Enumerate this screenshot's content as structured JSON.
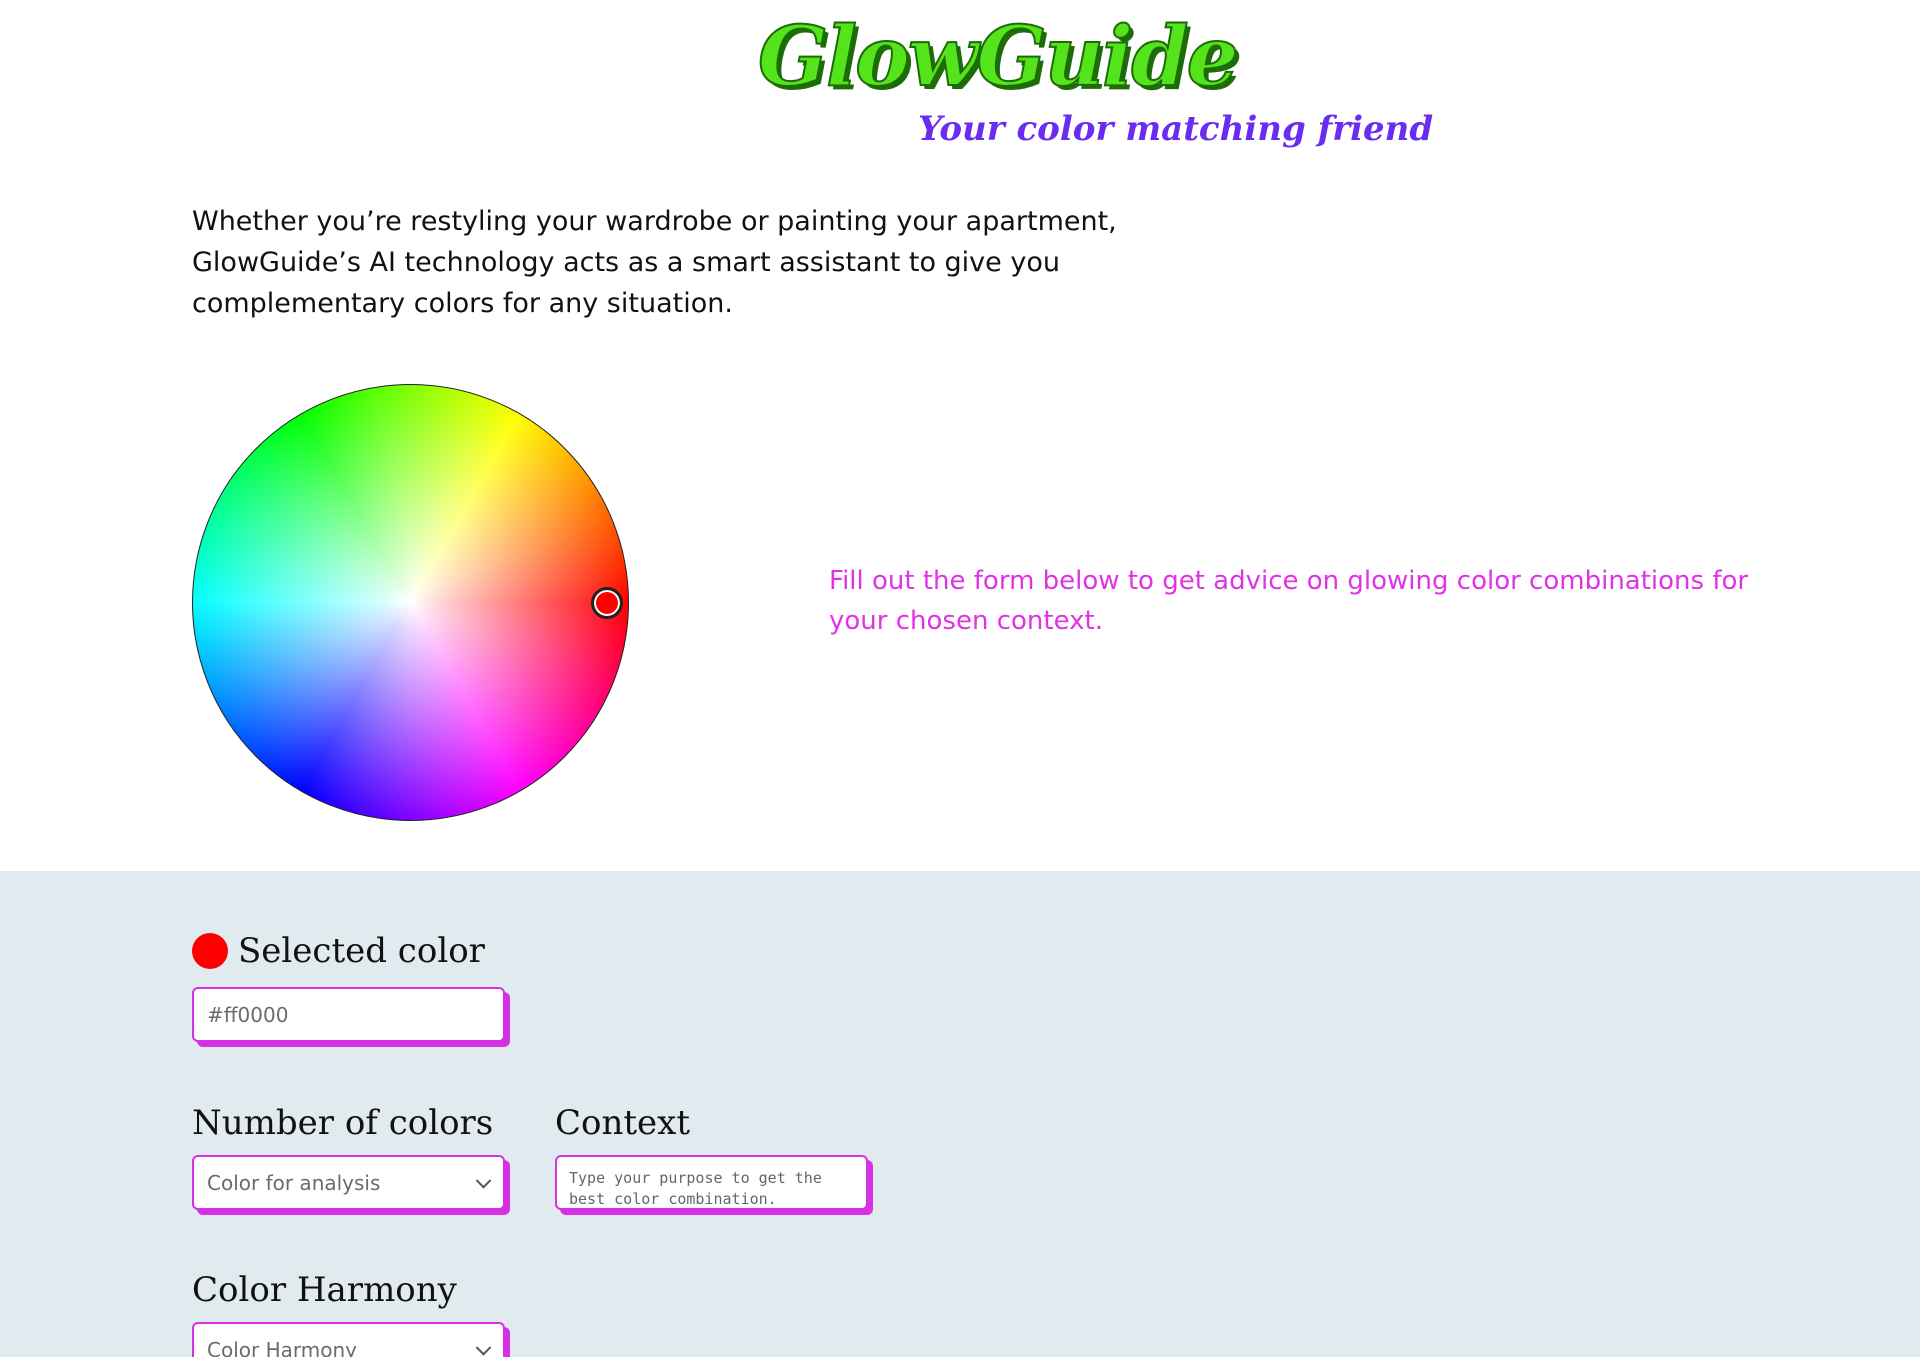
{
  "brand": {
    "title": "GlowGuide",
    "tagline": "Your color matching friend"
  },
  "intro": {
    "text": "Whether you’re restyling your wardrobe or painting your apartment, GlowGuide’s AI technology acts as a smart assistant to give you complementary colors for any situation."
  },
  "color_wheel": {
    "selected_hex": "#ff0000"
  },
  "advice": {
    "text": "Fill out the form below to get advice on glowing color combinations for your chosen context."
  },
  "form": {
    "selected_color": {
      "heading": "Selected color",
      "swatch_color": "#ff0000",
      "input_value": "#ff0000"
    },
    "number_of_colors": {
      "heading": "Number of colors",
      "selected_option": "Color for analysis"
    },
    "context": {
      "heading": "Context",
      "placeholder": "Type your purpose to get the best color combination."
    },
    "color_harmony": {
      "heading": "Color Harmony",
      "selected_option": "Color Harmony"
    }
  },
  "colors": {
    "brand_green": "#55e41b",
    "tagline_purple": "#6a2cf0",
    "accent_magenta": "#d630e6",
    "advice_magenta": "#e033e6",
    "form_background": "#e0eaef"
  }
}
